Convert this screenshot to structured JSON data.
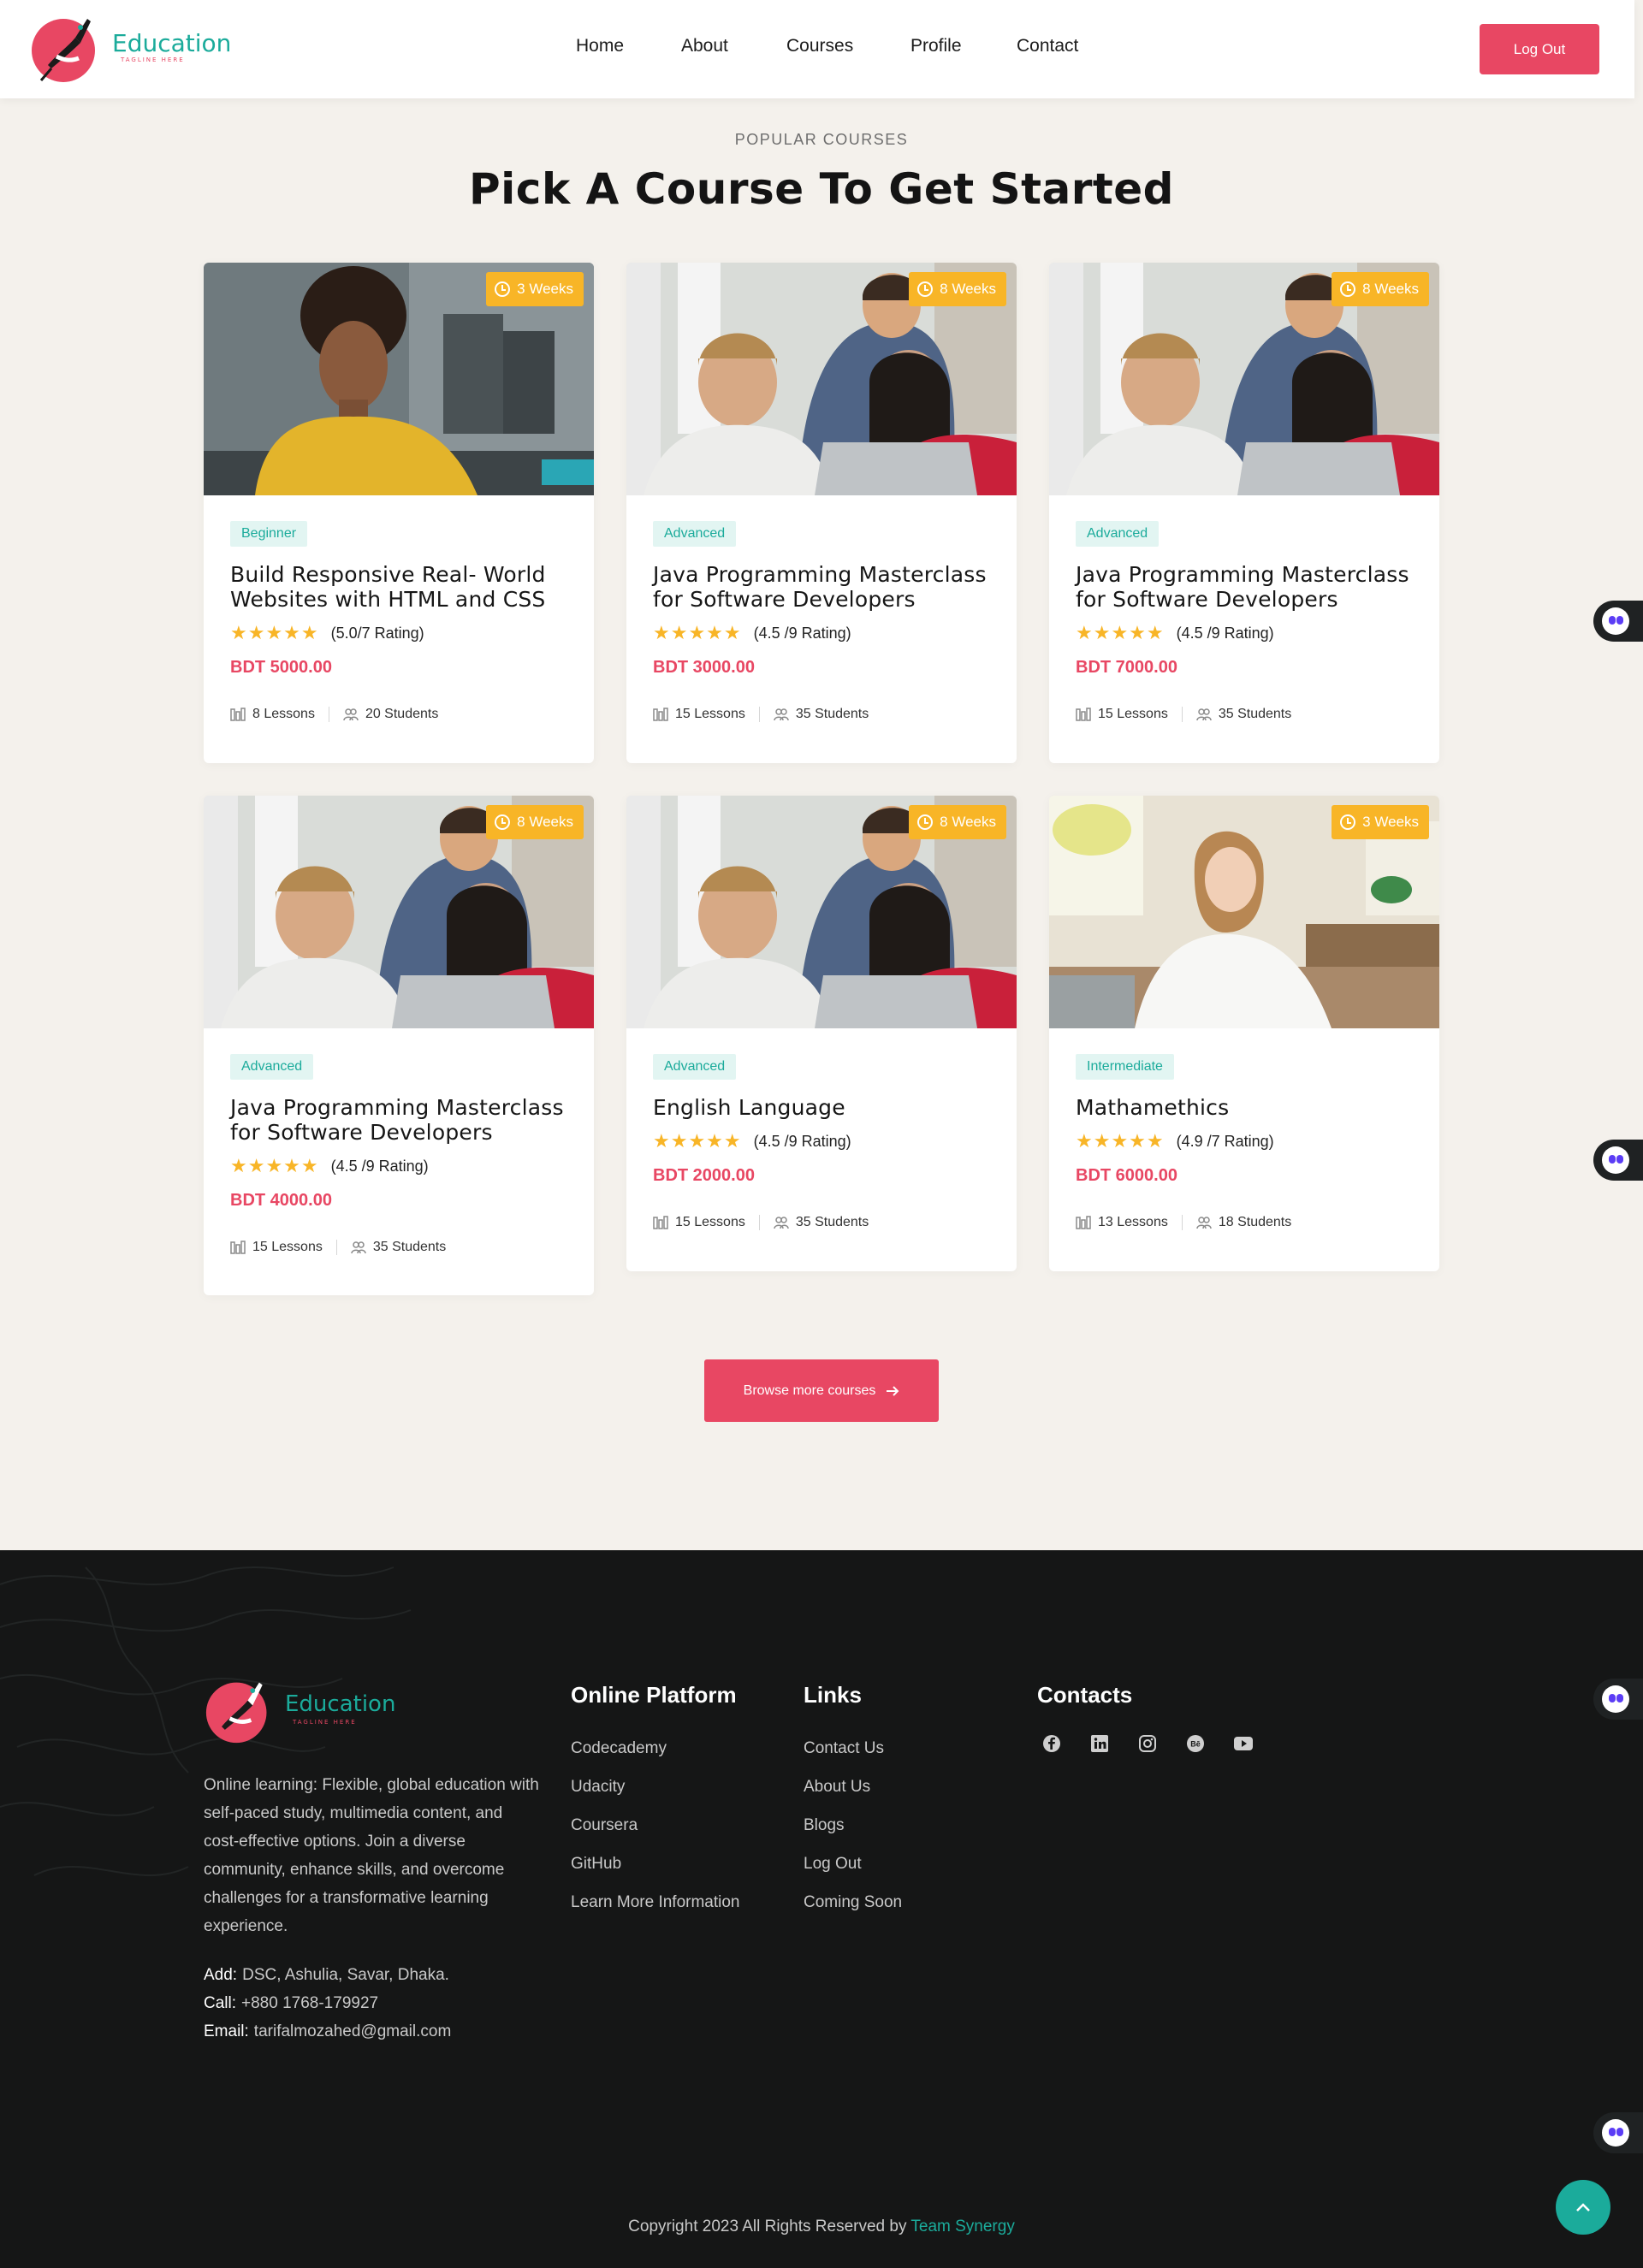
{
  "brand": {
    "name": "Education",
    "tagline": "TAGLINE HERE",
    "accent": "#e84763",
    "teal": "#1bab9b",
    "amber": "#f8b527"
  },
  "nav": {
    "items": [
      {
        "label": "Home"
      },
      {
        "label": "About"
      },
      {
        "label": "Courses"
      },
      {
        "label": "Profile"
      },
      {
        "label": "Contact"
      }
    ],
    "logout_label": "Log Out"
  },
  "section": {
    "eyebrow": "POPULAR COURSES",
    "title": "Pick A Course To Get Started"
  },
  "courses": [
    {
      "duration": "3 Weeks",
      "level": "Beginner",
      "title": "Build Responsive Real- World Websites with HTML and CSS",
      "stars": "★★★★★",
      "rating": "(5.0/7 Rating)",
      "price": "BDT 5000.00",
      "lessons": "8 Lessons",
      "students": "20 Students",
      "image": "student-yellow-shirt"
    },
    {
      "duration": "8 Weeks",
      "level": "Advanced",
      "title": "Java Programming Masterclass for Software Developers",
      "stars": "★★★★★",
      "rating": "(4.5 /9 Rating)",
      "price": "BDT 3000.00",
      "lessons": "15 Lessons",
      "students": "35 Students",
      "image": "group-at-laptop"
    },
    {
      "duration": "8 Weeks",
      "level": "Advanced",
      "title": "Java Programming Masterclass for Software Developers",
      "stars": "★★★★★",
      "rating": "(4.5 /9 Rating)",
      "price": "BDT 7000.00",
      "lessons": "15 Lessons",
      "students": "35 Students",
      "image": "group-at-laptop"
    },
    {
      "duration": "8 Weeks",
      "level": "Advanced",
      "title": "Java Programming Masterclass for Software Developers",
      "stars": "★★★★★",
      "rating": "(4.5 /9 Rating)",
      "price": "BDT 4000.00",
      "lessons": "15 Lessons",
      "students": "35 Students",
      "image": "group-at-laptop"
    },
    {
      "duration": "8 Weeks",
      "level": "Advanced",
      "title": "English Language",
      "stars": "★★★★★",
      "rating": "(4.5 /9 Rating)",
      "price": "BDT 2000.00",
      "lessons": "15 Lessons",
      "students": "35 Students",
      "image": "group-at-laptop"
    },
    {
      "duration": "3 Weeks",
      "level": "Intermediate",
      "title": "Mathamethics",
      "stars": "★★★★★",
      "rating": "(4.9 /7 Rating)",
      "price": "BDT 6000.00",
      "lessons": "13 Lessons",
      "students": "18 Students",
      "image": "woman-at-desk"
    }
  ],
  "browse_label": "Browse more courses",
  "footer": {
    "about": "Online learning: Flexible, global education with self-paced study, multimedia content, and cost-effective options. Join a diverse community, enhance skills, and overcome challenges for a transformative learning experience.",
    "add_label": "Add:",
    "add_value": "DSC, Ashulia, Savar, Dhaka.",
    "call_label": "Call:",
    "call_value": "+880 1768-179927",
    "email_label": "Email:",
    "email_value": "tarifalmozahed@gmail.com",
    "platform_title": "Online Platform",
    "platform_links": [
      "Codecademy",
      "Udacity",
      "Coursera",
      "GitHub",
      "Learn More Information"
    ],
    "links_title": "Links",
    "links": [
      "Contact Us",
      "About Us",
      "Blogs",
      "Log Out",
      "Coming Soon"
    ],
    "contacts_title": "Contacts",
    "socials": [
      "facebook-icon",
      "linkedin-icon",
      "instagram-icon",
      "behance-icon",
      "youtube-icon"
    ],
    "copyright": "Copyright 2023 All Rights Reserved by",
    "copyright_brand": "Team Synergy"
  }
}
